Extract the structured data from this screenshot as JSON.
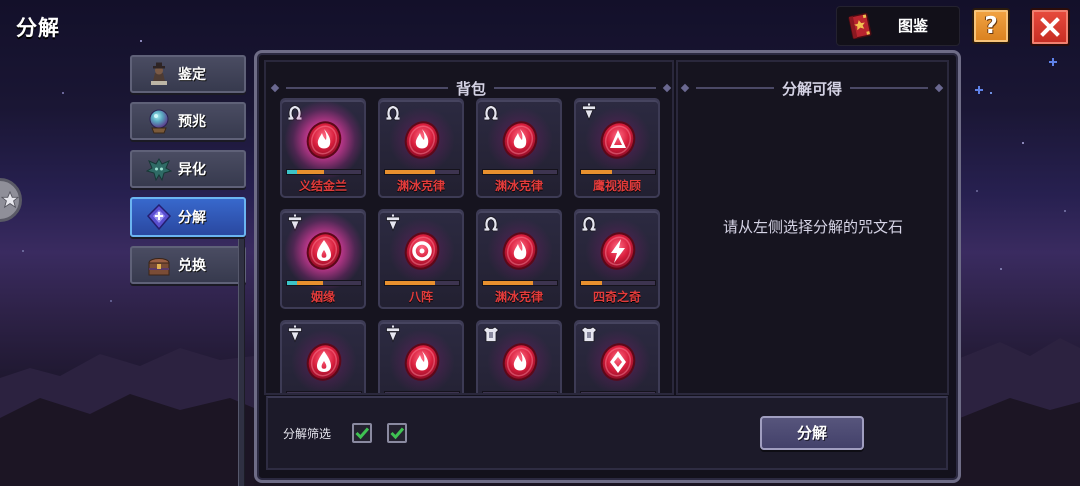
{
  "screen": {
    "title": "分解"
  },
  "topbar": {
    "codex": {
      "label": "图鉴",
      "icon": "codex-book-icon"
    },
    "help": {
      "glyph": "?",
      "icon": "question-icon"
    },
    "close": {
      "icon": "close-icon"
    }
  },
  "side_handle": {
    "icon": "star-icon"
  },
  "sidebar": {
    "items": [
      {
        "label": "鉴定",
        "icon": "appraise-icon",
        "active": false
      },
      {
        "label": "预兆",
        "icon": "omen-orb-icon",
        "active": false
      },
      {
        "label": "异化",
        "icon": "mutation-icon",
        "active": false
      },
      {
        "label": "分解",
        "icon": "decompose-crystal-icon",
        "active": true
      },
      {
        "label": "兑换",
        "icon": "exchange-chest-icon",
        "active": false
      }
    ]
  },
  "backpack": {
    "title": "背包",
    "items": [
      {
        "name": "义结金兰",
        "slot_icon": "necklace-icon",
        "rune_symbol": "flame",
        "glow": true,
        "progress": [
          {
            "color": "#e8902e",
            "fraction": 0.5
          },
          {
            "color": "#3cc4c8",
            "fraction": 0.13
          }
        ]
      },
      {
        "name": "渊冰克律",
        "slot_icon": "necklace-icon",
        "rune_symbol": "flame",
        "glow": false,
        "progress": [
          {
            "color": "#e8902e",
            "fraction": 0.68
          }
        ]
      },
      {
        "name": "渊冰克律",
        "slot_icon": "necklace-icon",
        "rune_symbol": "flame",
        "glow": false,
        "progress": [
          {
            "color": "#e8902e",
            "fraction": 0.68
          }
        ]
      },
      {
        "name": "鹰视狼顾",
        "slot_icon": "pendant-icon",
        "rune_symbol": "triangle",
        "glow": false,
        "progress": [
          {
            "color": "#e8902e",
            "fraction": 0.42
          }
        ]
      },
      {
        "name": "姻缘",
        "slot_icon": "pendant-icon",
        "rune_symbol": "drop",
        "glow": true,
        "progress": [
          {
            "color": "#e8902e",
            "fraction": 0.48
          },
          {
            "color": "#3cc4c8",
            "fraction": 0.13
          }
        ]
      },
      {
        "name": "八阵",
        "slot_icon": "pendant-icon",
        "rune_symbol": "ring",
        "glow": false,
        "progress": [
          {
            "color": "#e8902e",
            "fraction": 0.68
          }
        ]
      },
      {
        "name": "渊冰克律",
        "slot_icon": "necklace-icon",
        "rune_symbol": "flame",
        "glow": false,
        "progress": [
          {
            "color": "#e8902e",
            "fraction": 0.68
          }
        ]
      },
      {
        "name": "四奇之奇",
        "slot_icon": "necklace-icon",
        "rune_symbol": "bolt",
        "glow": false,
        "progress": [
          {
            "color": "#e8902e",
            "fraction": 0.28
          }
        ]
      },
      {
        "slot_icon": "pendant-icon",
        "rune_symbol": "drop",
        "glow": false
      },
      {
        "slot_icon": "pendant-icon",
        "rune_symbol": "flame",
        "glow": false
      },
      {
        "slot_icon": "armor-icon",
        "rune_symbol": "flame",
        "glow": false
      },
      {
        "slot_icon": "armor-icon",
        "rune_symbol": "diamond",
        "glow": false
      }
    ]
  },
  "rewards": {
    "title": "分解可得",
    "empty_hint": "请从左侧选择分解的咒文石"
  },
  "footer": {
    "filter_label": "分解筛选",
    "filters": [
      {
        "checked": true
      },
      {
        "checked": true
      }
    ],
    "decompose_button": "分解"
  },
  "colors": {
    "rune_name": "#e23b3b",
    "active_tab": "#2f52b0",
    "check": "#3fc252",
    "help_button": "#e8902e",
    "close_button": "#d8382c"
  }
}
